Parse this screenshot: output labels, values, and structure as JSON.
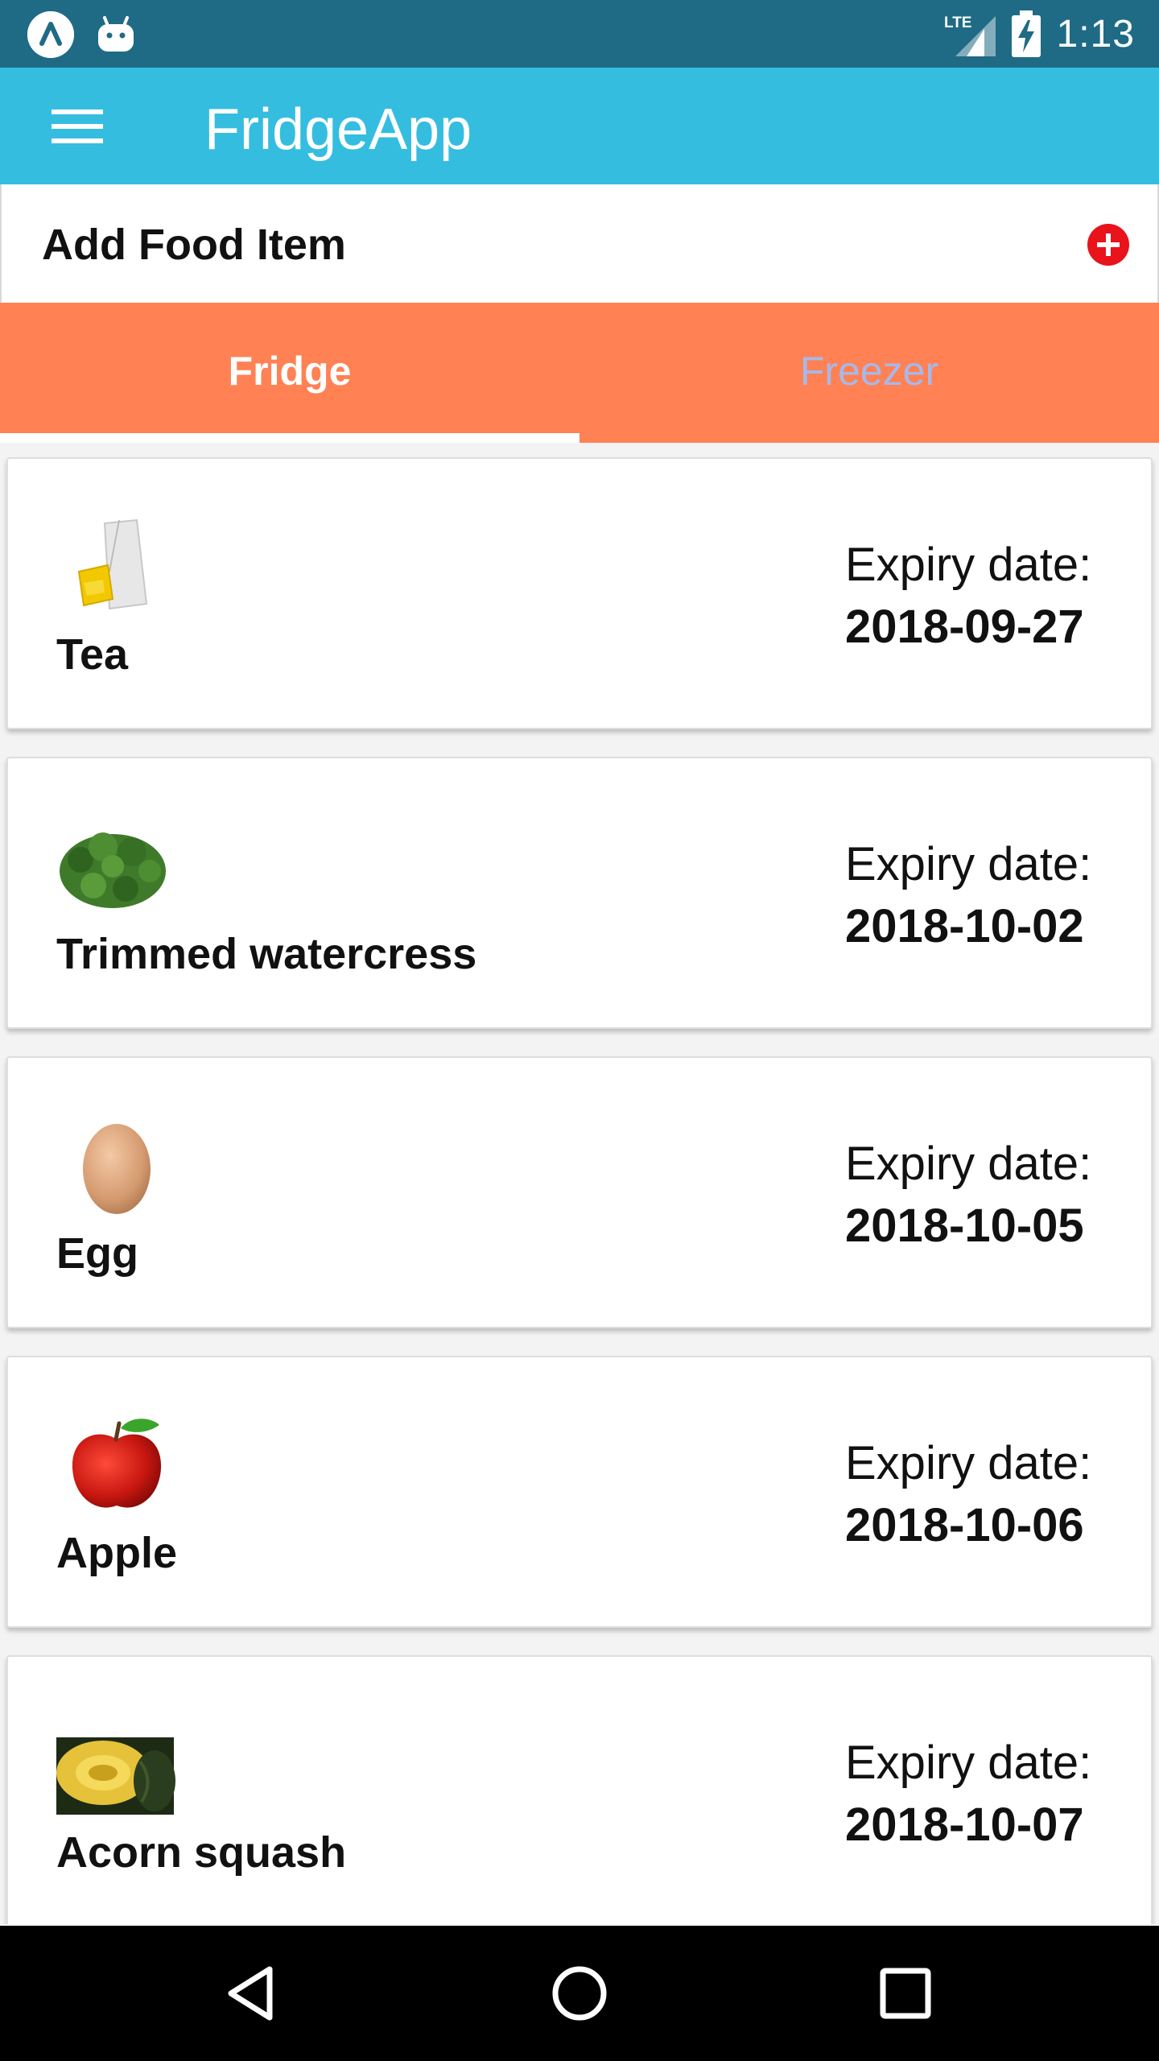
{
  "status_bar": {
    "time": "1:13",
    "network": "LTE"
  },
  "app_bar": {
    "title": "FridgeApp",
    "menu_icon": "hamburger-menu-icon"
  },
  "add_food": {
    "label": "Add Food Item",
    "icon": "add-circle-icon",
    "icon_color": "#e8131b"
  },
  "tabs": [
    {
      "label": "Fridge",
      "selected": true
    },
    {
      "label": "Freezer",
      "selected": false
    }
  ],
  "colors": {
    "status_bar": "#1f6b85",
    "app_bar": "#35bde0",
    "tab_bar": "#ff8154",
    "inactive_tab_text": "#a8b8e8"
  },
  "items": [
    {
      "name": "Tea",
      "expiry_label": "Expiry date:",
      "expiry_date": "2018-09-27",
      "image": "tea-bag-image"
    },
    {
      "name": "Trimmed watercress",
      "expiry_label": "Expiry date:",
      "expiry_date": "2018-10-02",
      "image": "watercress-image"
    },
    {
      "name": "Egg",
      "expiry_label": "Expiry date:",
      "expiry_date": "2018-10-05",
      "image": "egg-image"
    },
    {
      "name": "Apple",
      "expiry_label": "Expiry date:",
      "expiry_date": "2018-10-06",
      "image": "apple-image"
    },
    {
      "name": "Acorn squash",
      "expiry_label": "Expiry date:",
      "expiry_date": "2018-10-07",
      "image": "acorn-squash-image"
    }
  ],
  "nav_bar": {
    "buttons": [
      "back-icon",
      "home-icon",
      "recents-icon"
    ]
  }
}
